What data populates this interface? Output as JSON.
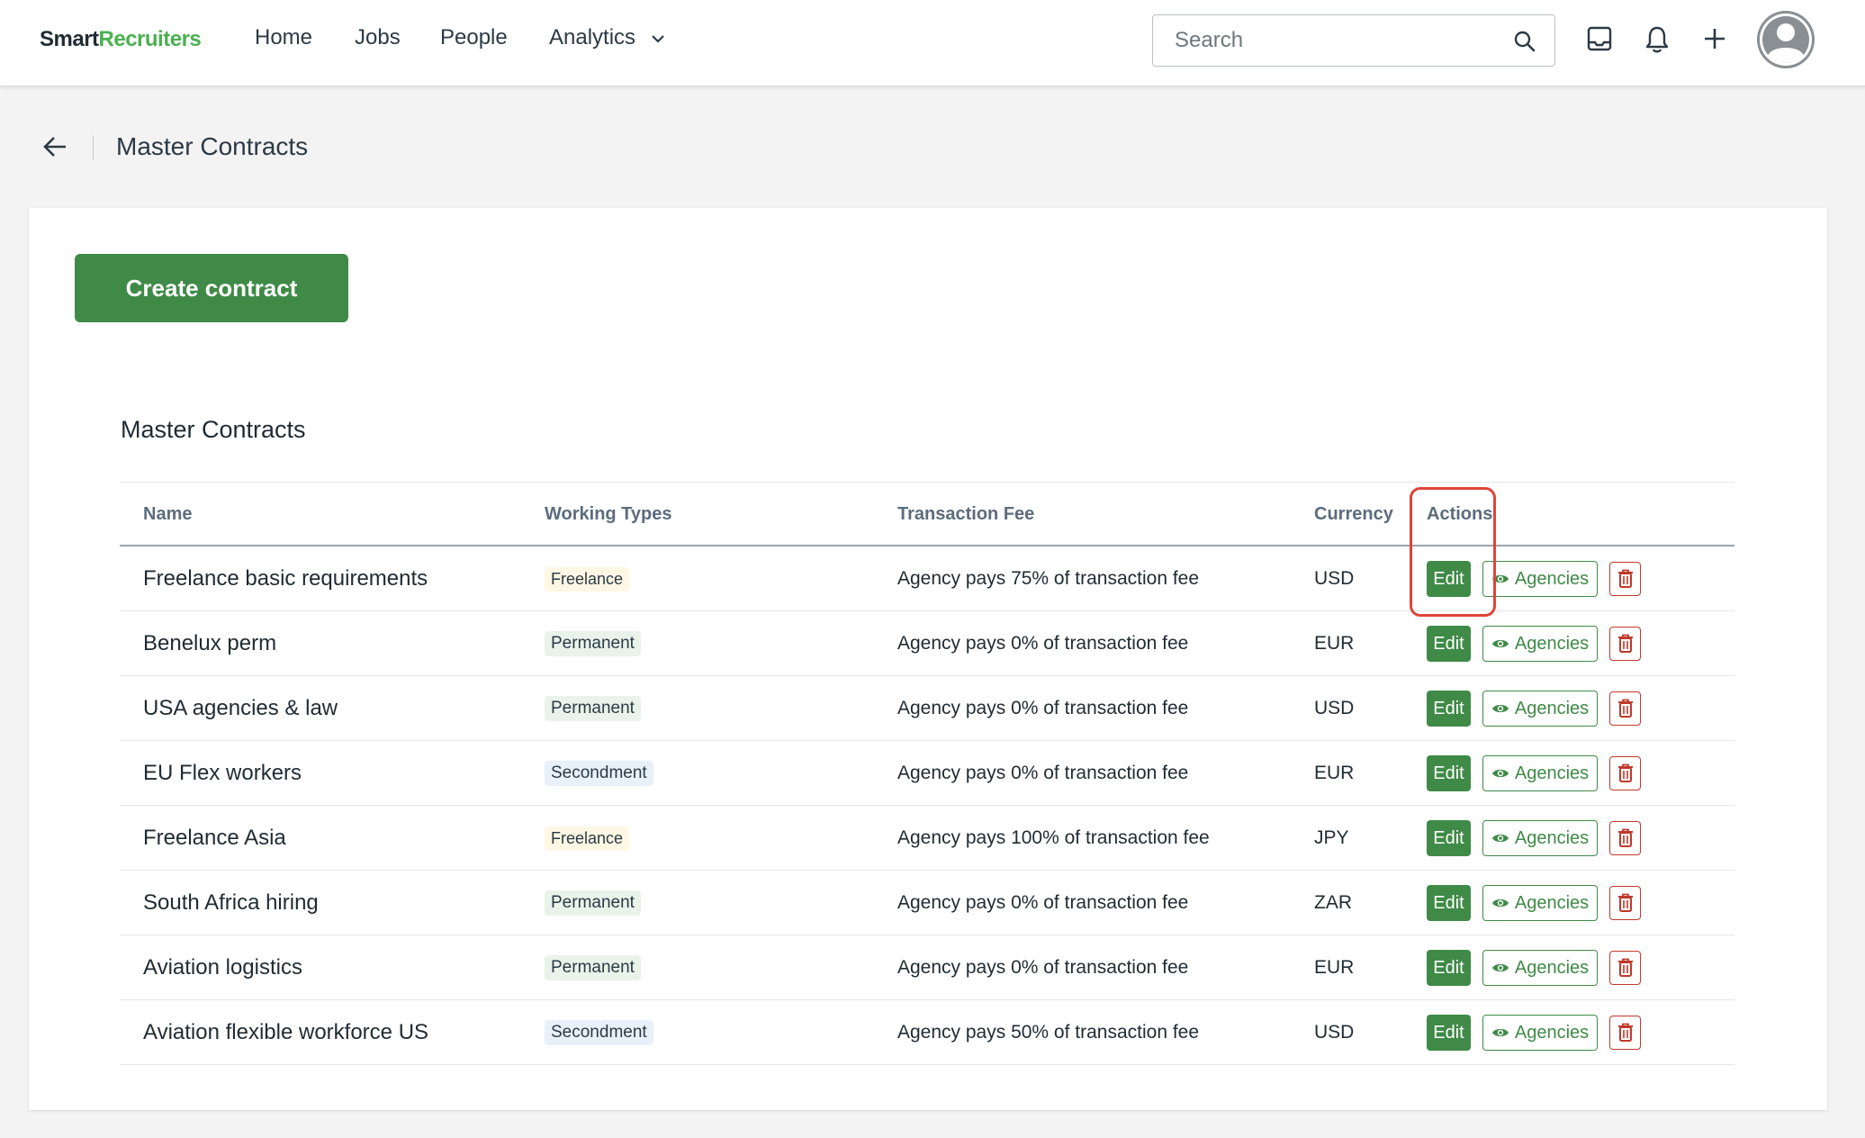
{
  "nav": {
    "logo_part1": "Smart",
    "logo_part2": "Recruiters",
    "items": [
      "Home",
      "Jobs",
      "People",
      "Analytics"
    ],
    "search_placeholder": "Search",
    "icons": [
      "inbox-icon",
      "bell-icon",
      "plus-icon",
      "avatar"
    ]
  },
  "header": {
    "title": "Master Contracts"
  },
  "card": {
    "create_label": "Create contract",
    "section_title": "Master Contracts"
  },
  "table": {
    "columns": [
      "Name",
      "Working Types",
      "Transaction Fee",
      "Currency",
      "Actions"
    ],
    "rows": [
      {
        "name": "Freelance basic requirements",
        "type": "Freelance",
        "fee": "Agency pays 75% of transaction fee",
        "currency": "USD"
      },
      {
        "name": "Benelux perm",
        "type": "Permanent",
        "fee": "Agency pays 0% of transaction fee",
        "currency": "EUR"
      },
      {
        "name": "USA agencies & law",
        "type": "Permanent",
        "fee": "Agency pays 0% of transaction fee",
        "currency": "USD"
      },
      {
        "name": "EU Flex workers",
        "type": "Secondment",
        "fee": "Agency pays 0% of transaction fee",
        "currency": "EUR"
      },
      {
        "name": "Freelance Asia",
        "type": "Freelance",
        "fee": "Agency pays 100% of transaction fee",
        "currency": "JPY"
      },
      {
        "name": "South Africa hiring",
        "type": "Permanent",
        "fee": "Agency pays 0% of transaction fee",
        "currency": "ZAR"
      },
      {
        "name": "Aviation logistics",
        "type": "Permanent",
        "fee": "Agency pays 0% of transaction fee",
        "currency": "EUR"
      },
      {
        "name": "Aviation flexible workforce US",
        "type": "Secondment",
        "fee": "Agency pays 50% of transaction fee",
        "currency": "USD"
      }
    ],
    "edit_label": "Edit",
    "agencies_label": "Agencies"
  },
  "colors": {
    "brand_green": "#3f8a47",
    "logo_green": "#4caf50",
    "delete_red": "#c0392b",
    "highlight_red": "#e0443a"
  }
}
